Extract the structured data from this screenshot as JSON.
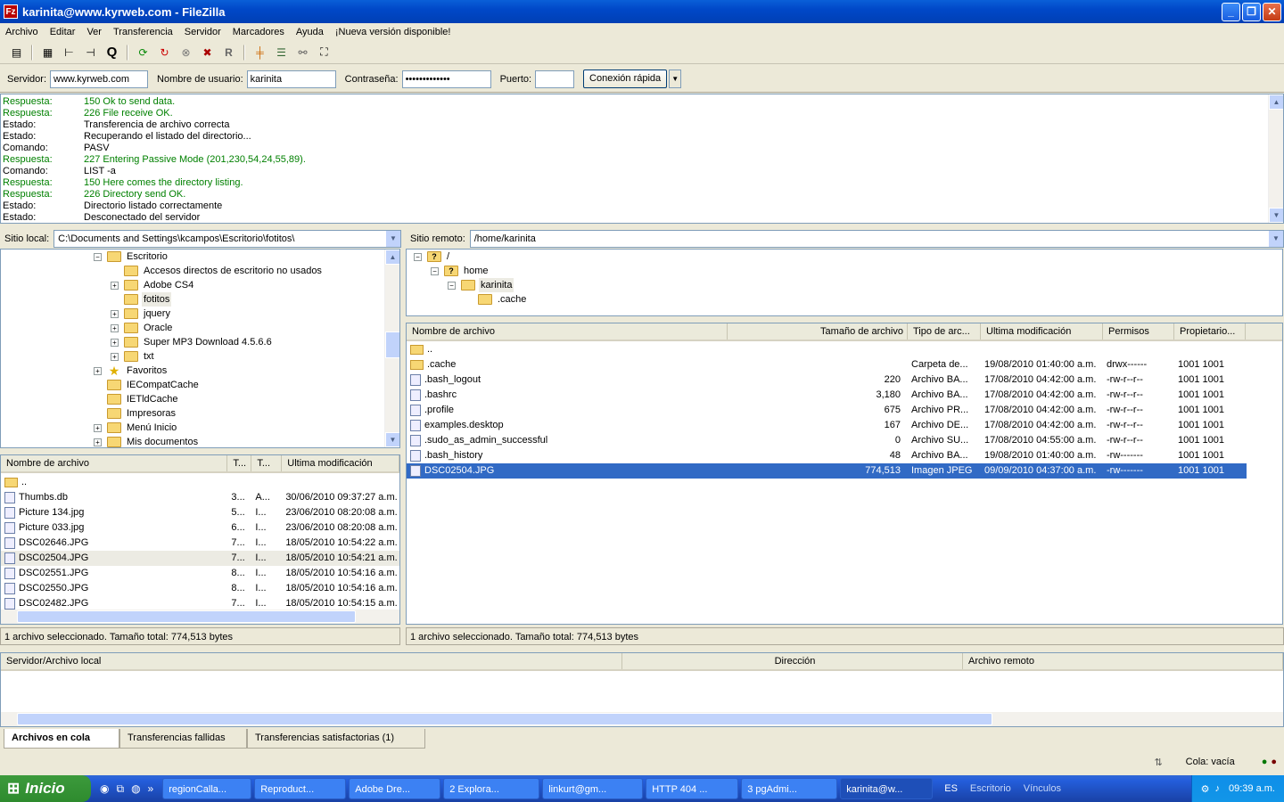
{
  "window": {
    "title": "karinita@www.kyrweb.com - FileZilla",
    "min": "_",
    "max": "❐",
    "close": "✕"
  },
  "menu": [
    "Archivo",
    "Editar",
    "Ver",
    "Transferencia",
    "Servidor",
    "Marcadores",
    "Ayuda",
    "¡Nueva versión disponible!"
  ],
  "quickconnect": {
    "server_label": "Servidor:",
    "server_value": "www.kyrweb.com",
    "user_label": "Nombre de usuario:",
    "user_value": "karinita",
    "pass_label": "Contraseña:",
    "pass_value": "•••••••••••••",
    "port_label": "Puerto:",
    "port_value": "",
    "button": "Conexión rápida"
  },
  "log": [
    {
      "k": "Respuesta:",
      "v": "150 Ok to send data.",
      "type": "resp"
    },
    {
      "k": "Respuesta:",
      "v": "226 File receive OK.",
      "type": "resp"
    },
    {
      "k": "Estado:",
      "v": "Transferencia de archivo correcta",
      "type": "st"
    },
    {
      "k": "Estado:",
      "v": "Recuperando el listado del directorio...",
      "type": "st"
    },
    {
      "k": "Comando:",
      "v": "PASV",
      "type": "st"
    },
    {
      "k": "Respuesta:",
      "v": "227 Entering Passive Mode (201,230,54,24,55,89).",
      "type": "resp"
    },
    {
      "k": "Comando:",
      "v": "LIST -a",
      "type": "st"
    },
    {
      "k": "Respuesta:",
      "v": "150 Here comes the directory listing.",
      "type": "resp"
    },
    {
      "k": "Respuesta:",
      "v": "226 Directory send OK.",
      "type": "resp"
    },
    {
      "k": "Estado:",
      "v": "Directorio listado correctamente",
      "type": "st"
    },
    {
      "k": "Estado:",
      "v": "Desconectado del servidor",
      "type": "st"
    }
  ],
  "local": {
    "label": "Sitio local:",
    "path": "C:\\Documents and Settings\\kcampos\\Escritorio\\fotitos\\",
    "tree": [
      {
        "name": "Escritorio",
        "exp": "−",
        "lvl": 0
      },
      {
        "name": "Accesos directos de escritorio no usados",
        "exp": "",
        "lvl": 1
      },
      {
        "name": "Adobe CS4",
        "exp": "+",
        "lvl": 1
      },
      {
        "name": "fotitos",
        "exp": "",
        "lvl": 1,
        "sel": true
      },
      {
        "name": "jquery",
        "exp": "+",
        "lvl": 1
      },
      {
        "name": "Oracle",
        "exp": "+",
        "lvl": 1
      },
      {
        "name": "Super MP3 Download 4.5.6.6",
        "exp": "+",
        "lvl": 1
      },
      {
        "name": "txt",
        "exp": "+",
        "lvl": 1
      },
      {
        "name": "Favoritos",
        "exp": "+",
        "lvl": -1,
        "star": true
      },
      {
        "name": "IECompatCache",
        "exp": "",
        "lvl": -1
      },
      {
        "name": "IETldCache",
        "exp": "",
        "lvl": -1
      },
      {
        "name": "Impresoras",
        "exp": "",
        "lvl": -1
      },
      {
        "name": "Menú Inicio",
        "exp": "+",
        "lvl": -1
      },
      {
        "name": "Mis documentos",
        "exp": "+",
        "lvl": -1
      }
    ],
    "cols": [
      "Nombre de archivo",
      "T...",
      "T...",
      "Ultima modificación"
    ],
    "files": [
      {
        "n": "..",
        "s": "",
        "t": "",
        "m": ""
      },
      {
        "n": "Thumbs.db",
        "s": "3...",
        "t": "A...",
        "m": "30/06/2010 09:37:27 a.m."
      },
      {
        "n": "Picture 134.jpg",
        "s": "5...",
        "t": "I...",
        "m": "23/06/2010 08:20:08 a.m."
      },
      {
        "n": "Picture 033.jpg",
        "s": "6...",
        "t": "I...",
        "m": "23/06/2010 08:20:08 a.m."
      },
      {
        "n": "DSC02646.JPG",
        "s": "7...",
        "t": "I...",
        "m": "18/05/2010 10:54:22 a.m."
      },
      {
        "n": "DSC02504.JPG",
        "s": "7...",
        "t": "I...",
        "m": "18/05/2010 10:54:21 a.m."
      },
      {
        "n": "DSC02551.JPG",
        "s": "8...",
        "t": "I...",
        "m": "18/05/2010 10:54:16 a.m."
      },
      {
        "n": "DSC02550.JPG",
        "s": "8...",
        "t": "I...",
        "m": "18/05/2010 10:54:16 a.m."
      },
      {
        "n": "DSC02482.JPG",
        "s": "7...",
        "t": "I...",
        "m": "18/05/2010 10:54:15 a.m."
      }
    ],
    "status": "1 archivo seleccionado. Tamaño total: 774,513 bytes"
  },
  "remote": {
    "label": "Sitio remoto:",
    "path": "/home/karinita",
    "tree": [
      {
        "name": "/",
        "exp": "−",
        "x": 0,
        "q": true
      },
      {
        "name": "home",
        "exp": "−",
        "x": 1,
        "q": true
      },
      {
        "name": "karinita",
        "exp": "−",
        "x": 2,
        "sel": true
      },
      {
        "name": ".cache",
        "exp": "",
        "x": 3
      }
    ],
    "cols": [
      "Nombre de archivo",
      "Tamaño de archivo",
      "Tipo de arc...",
      "Ultima modificación",
      "Permisos",
      "Propietario..."
    ],
    "files": [
      {
        "n": "..",
        "s": "",
        "t": "",
        "m": "",
        "p": "",
        "o": "",
        "folder": true
      },
      {
        "n": ".cache",
        "s": "",
        "t": "Carpeta de...",
        "m": "19/08/2010 01:40:00 a.m.",
        "p": "drwx------",
        "o": "1001 1001",
        "folder": true
      },
      {
        "n": ".bash_logout",
        "s": "220",
        "t": "Archivo BA...",
        "m": "17/08/2010 04:42:00 a.m.",
        "p": "-rw-r--r--",
        "o": "1001 1001"
      },
      {
        "n": ".bashrc",
        "s": "3,180",
        "t": "Archivo BA...",
        "m": "17/08/2010 04:42:00 a.m.",
        "p": "-rw-r--r--",
        "o": "1001 1001"
      },
      {
        "n": ".profile",
        "s": "675",
        "t": "Archivo PR...",
        "m": "17/08/2010 04:42:00 a.m.",
        "p": "-rw-r--r--",
        "o": "1001 1001"
      },
      {
        "n": "examples.desktop",
        "s": "167",
        "t": "Archivo DE...",
        "m": "17/08/2010 04:42:00 a.m.",
        "p": "-rw-r--r--",
        "o": "1001 1001"
      },
      {
        "n": ".sudo_as_admin_successful",
        "s": "0",
        "t": "Archivo SU...",
        "m": "17/08/2010 04:55:00 a.m.",
        "p": "-rw-r--r--",
        "o": "1001 1001"
      },
      {
        "n": ".bash_history",
        "s": "48",
        "t": "Archivo BA...",
        "m": "19/08/2010 01:40:00 a.m.",
        "p": "-rw-------",
        "o": "1001 1001"
      },
      {
        "n": "DSC02504.JPG",
        "s": "774,513",
        "t": "Imagen JPEG",
        "m": "09/09/2010 04:37:00 a.m.",
        "p": "-rw-------",
        "o": "1001 1001",
        "sel": true
      }
    ],
    "status": "1 archivo seleccionado. Tamaño total: 774,513 bytes"
  },
  "queue": {
    "cols": [
      "Servidor/Archivo local",
      "Dirección",
      "Archivo remoto"
    ]
  },
  "tabs": [
    "Archivos en cola",
    "Transferencias fallidas",
    "Transferencias satisfactorias (1)"
  ],
  "bottom_status": "Cola: vacía",
  "taskbar": {
    "start": "Inicio",
    "buttons": [
      "regionCalla...",
      "Reproduct...",
      "Adobe Dre...",
      "2 Explora...",
      "linkurt@gm...",
      "HTTP 404 ...",
      "3 pgAdmi...",
      "karinita@w..."
    ],
    "lang": "ES",
    "desk": "Escritorio",
    "links": "Vínculos",
    "clock": "09:39 a.m."
  }
}
